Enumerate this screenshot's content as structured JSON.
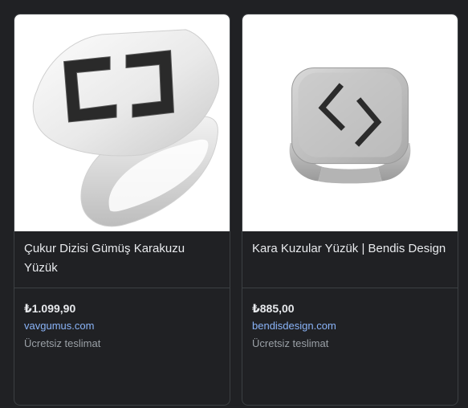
{
  "products": [
    {
      "title": "Çukur Dizisi Gümüş Karakuzu Yüzük",
      "price": "₺1.099,90",
      "merchant": "vavgumus.com",
      "shipping": "Ücretsiz teslimat",
      "image_icon": "signet-ring-icon"
    },
    {
      "title": "Kara Kuzular Yüzük | Bendis Design",
      "price": "₺885,00",
      "merchant": "bendisdesign.com",
      "shipping": "Ücretsiz teslimat",
      "image_icon": "open-band-ring-icon"
    }
  ]
}
